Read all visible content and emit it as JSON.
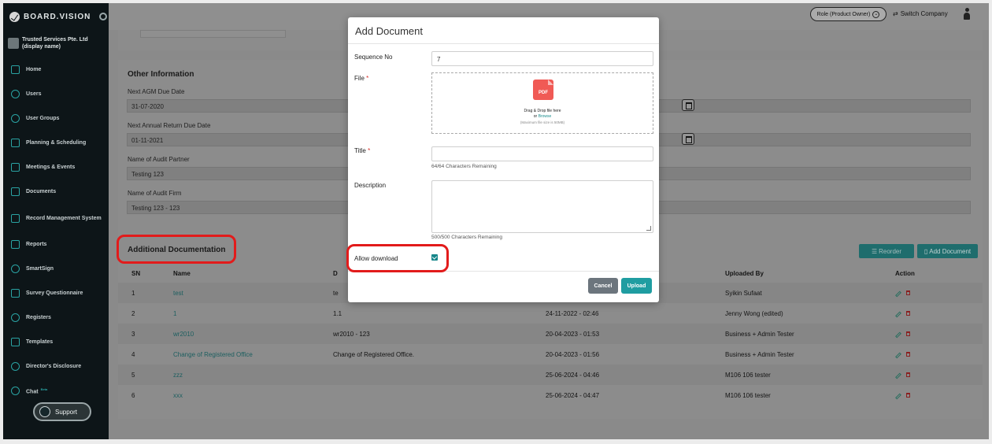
{
  "brand": {
    "name": "BOARD.VISION"
  },
  "company": {
    "name_line1": "Trusted Services Pte. Ltd",
    "name_line2": "(display name)"
  },
  "sidebar": {
    "items": [
      {
        "label": "Home",
        "badge": ""
      },
      {
        "label": "Users",
        "badge": ""
      },
      {
        "label": "User Groups",
        "badge": ""
      },
      {
        "label": "Planning & Scheduling",
        "badge": ""
      },
      {
        "label": "Meetings & Events",
        "badge": ""
      },
      {
        "label": "Documents",
        "badge": ""
      },
      {
        "label": "Record Management System",
        "badge": ""
      },
      {
        "label": "Reports",
        "badge": ""
      },
      {
        "label": "SmartSign",
        "badge": ""
      },
      {
        "label": "Survey Questionnaire",
        "badge": ""
      },
      {
        "label": "Registers",
        "badge": ""
      },
      {
        "label": "Templates",
        "badge": ""
      },
      {
        "label": "Director's Disclosure",
        "badge": ""
      },
      {
        "label": "Chat",
        "badge": "Beta"
      }
    ],
    "support_label": "Support"
  },
  "topbar": {
    "role_label": "Role (Product Owner)",
    "switch_label": "Switch Company"
  },
  "other_info": {
    "title": "Other Information",
    "agm_label": "Next AGM Due Date",
    "agm_value": "31-07-2020",
    "annual_label": "Next Annual Return Due Date",
    "annual_value": "01-11-2021",
    "audit_partner_label": "Name of Audit Partner",
    "audit_partner_value": "Testing 123",
    "audit_firm_label": "Name of Audit Firm",
    "audit_firm_value": "Testing 123 - 123"
  },
  "additional": {
    "title": "Additional Documentation",
    "reorder_label": "Reorder",
    "add_label": "Add Document",
    "headers": {
      "sn": "SN",
      "name": "Name",
      "desc": "D",
      "by": "Uploaded By",
      "action": "Action"
    },
    "rows": [
      {
        "sn": "1",
        "name": "test",
        "desc": "te",
        "date": "",
        "by": "Syikin Sufaat"
      },
      {
        "sn": "2",
        "name": "1",
        "desc": "1.1",
        "date": "24-11-2022 - 02:46",
        "by": "Jenny Wong (edited)"
      },
      {
        "sn": "3",
        "name": "wr2010",
        "desc": "wr2010 - 123",
        "date": "20-04-2023 - 01:53",
        "by": "Business + Admin Tester"
      },
      {
        "sn": "4",
        "name": "Change of Registered Office",
        "desc": "Change of Registered Office.",
        "date": "20-04-2023 - 01:56",
        "by": "Business + Admin Tester"
      },
      {
        "sn": "5",
        "name": "zzz",
        "desc": "",
        "date": "25-06-2024 - 04:46",
        "by": "M106 106 tester"
      },
      {
        "sn": "6",
        "name": "xxx",
        "desc": "",
        "date": "25-06-2024 - 04:47",
        "by": "M106 106 tester"
      }
    ]
  },
  "modal": {
    "title": "Add Document",
    "sequence_label": "Sequence No",
    "sequence_value": "7",
    "file_label": "File",
    "required_mark": "*",
    "pdf_text": "PDF",
    "drop_line1": "Drag & Drop file here",
    "drop_or": "or",
    "drop_browse": "Browse",
    "drop_max": "(Maximum file size is 50MB)",
    "title_label": "Title",
    "title_value": "",
    "title_hint": "64/64 Characters Remaining",
    "description_label": "Description",
    "description_hint": "500/500 Characters Remaining",
    "allow_download_label": "Allow download",
    "allow_download_checked": true,
    "cancel_label": "Cancel",
    "upload_label": "Upload"
  },
  "colors": {
    "accent": "#1f9da1",
    "highlight": "#e21b1b",
    "sidebar_bg": "#0d1518"
  }
}
